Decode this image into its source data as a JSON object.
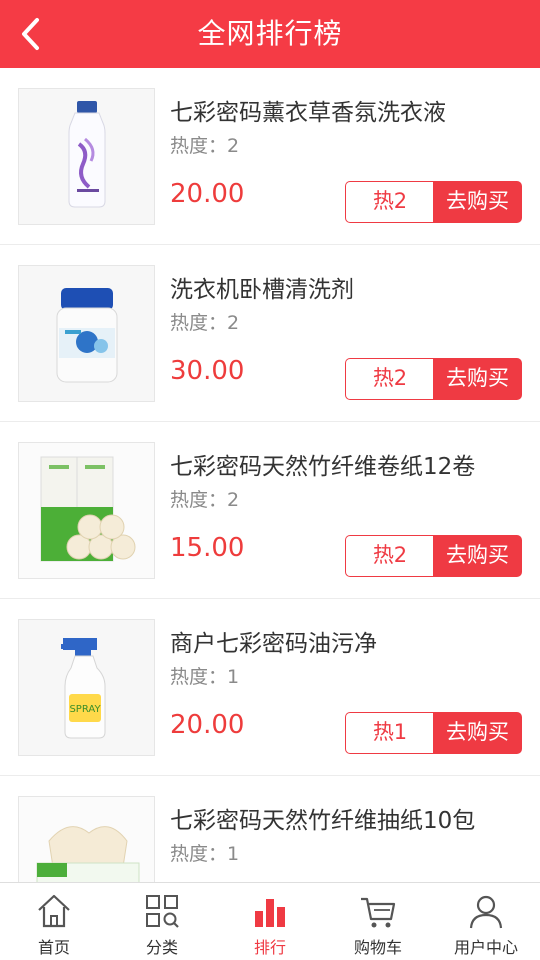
{
  "header": {
    "title": "全网排行榜",
    "back_icon": "chevron-left-icon",
    "background": "#f53b45"
  },
  "colors": {
    "accent": "#ef3a43",
    "price": "#ee3c3c",
    "text": "#333333",
    "muted": "#8a8a8a"
  },
  "products": [
    {
      "name": "七彩密码薰衣草香氛洗衣液",
      "heat": "热度：2",
      "price": "20.00",
      "hot_tag": "热2",
      "buy_label": "去购买",
      "image": "laundry-detergent-bottle"
    },
    {
      "name": "洗衣机卧槽清洗剂",
      "heat": "热度：2",
      "price": "30.00",
      "hot_tag": "热2",
      "buy_label": "去购买",
      "image": "washing-machine-cleaner-jar"
    },
    {
      "name": "七彩密码天然竹纤维卷纸12卷",
      "heat": "热度：2",
      "price": "15.00",
      "hot_tag": "热2",
      "buy_label": "去购买",
      "image": "bamboo-toilet-paper-rolls"
    },
    {
      "name": "商户七彩密码油污净",
      "heat": "热度：1",
      "price": "20.00",
      "hot_tag": "热1",
      "buy_label": "去购买",
      "image": "grease-cleaner-spray-bottle"
    },
    {
      "name": "七彩密码天然竹纤维抽纸10包",
      "heat": "热度：1",
      "price": "",
      "hot_tag": "",
      "buy_label": "",
      "image": "bamboo-tissue-box"
    }
  ],
  "tabbar": {
    "active": "排行",
    "tabs": [
      {
        "label": "首页",
        "icon": "home-icon"
      },
      {
        "label": "分类",
        "icon": "category-grid-icon"
      },
      {
        "label": "排行",
        "icon": "ranking-bars-icon"
      },
      {
        "label": "购物车",
        "icon": "cart-icon"
      },
      {
        "label": "用户中心",
        "icon": "user-icon"
      }
    ]
  }
}
